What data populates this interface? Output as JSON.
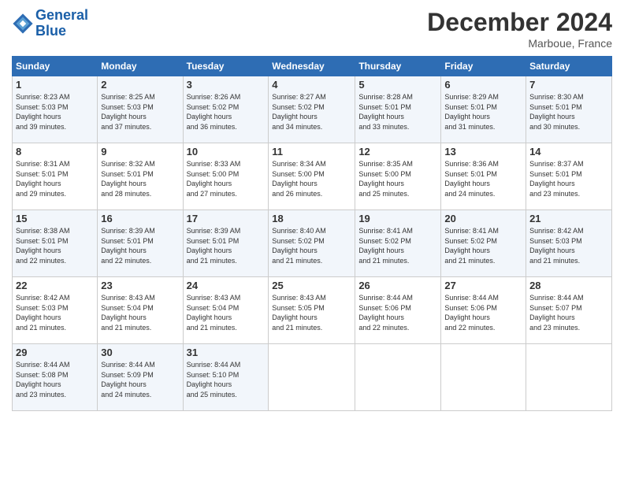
{
  "logo": {
    "line1": "General",
    "line2": "Blue"
  },
  "title": "December 2024",
  "location": "Marboue, France",
  "days_header": [
    "Sunday",
    "Monday",
    "Tuesday",
    "Wednesday",
    "Thursday",
    "Friday",
    "Saturday"
  ],
  "weeks": [
    [
      {
        "num": "1",
        "sunrise": "8:23 AM",
        "sunset": "5:03 PM",
        "daylight": "8 hours and 39 minutes."
      },
      {
        "num": "2",
        "sunrise": "8:25 AM",
        "sunset": "5:03 PM",
        "daylight": "8 hours and 37 minutes."
      },
      {
        "num": "3",
        "sunrise": "8:26 AM",
        "sunset": "5:02 PM",
        "daylight": "8 hours and 36 minutes."
      },
      {
        "num": "4",
        "sunrise": "8:27 AM",
        "sunset": "5:02 PM",
        "daylight": "8 hours and 34 minutes."
      },
      {
        "num": "5",
        "sunrise": "8:28 AM",
        "sunset": "5:01 PM",
        "daylight": "8 hours and 33 minutes."
      },
      {
        "num": "6",
        "sunrise": "8:29 AM",
        "sunset": "5:01 PM",
        "daylight": "8 hours and 31 minutes."
      },
      {
        "num": "7",
        "sunrise": "8:30 AM",
        "sunset": "5:01 PM",
        "daylight": "8 hours and 30 minutes."
      }
    ],
    [
      {
        "num": "8",
        "sunrise": "8:31 AM",
        "sunset": "5:01 PM",
        "daylight": "8 hours and 29 minutes."
      },
      {
        "num": "9",
        "sunrise": "8:32 AM",
        "sunset": "5:01 PM",
        "daylight": "8 hours and 28 minutes."
      },
      {
        "num": "10",
        "sunrise": "8:33 AM",
        "sunset": "5:00 PM",
        "daylight": "8 hours and 27 minutes."
      },
      {
        "num": "11",
        "sunrise": "8:34 AM",
        "sunset": "5:00 PM",
        "daylight": "8 hours and 26 minutes."
      },
      {
        "num": "12",
        "sunrise": "8:35 AM",
        "sunset": "5:00 PM",
        "daylight": "8 hours and 25 minutes."
      },
      {
        "num": "13",
        "sunrise": "8:36 AM",
        "sunset": "5:01 PM",
        "daylight": "8 hours and 24 minutes."
      },
      {
        "num": "14",
        "sunrise": "8:37 AM",
        "sunset": "5:01 PM",
        "daylight": "8 hours and 23 minutes."
      }
    ],
    [
      {
        "num": "15",
        "sunrise": "8:38 AM",
        "sunset": "5:01 PM",
        "daylight": "8 hours and 22 minutes."
      },
      {
        "num": "16",
        "sunrise": "8:39 AM",
        "sunset": "5:01 PM",
        "daylight": "8 hours and 22 minutes."
      },
      {
        "num": "17",
        "sunrise": "8:39 AM",
        "sunset": "5:01 PM",
        "daylight": "8 hours and 21 minutes."
      },
      {
        "num": "18",
        "sunrise": "8:40 AM",
        "sunset": "5:02 PM",
        "daylight": "8 hours and 21 minutes."
      },
      {
        "num": "19",
        "sunrise": "8:41 AM",
        "sunset": "5:02 PM",
        "daylight": "8 hours and 21 minutes."
      },
      {
        "num": "20",
        "sunrise": "8:41 AM",
        "sunset": "5:02 PM",
        "daylight": "8 hours and 21 minutes."
      },
      {
        "num": "21",
        "sunrise": "8:42 AM",
        "sunset": "5:03 PM",
        "daylight": "8 hours and 21 minutes."
      }
    ],
    [
      {
        "num": "22",
        "sunrise": "8:42 AM",
        "sunset": "5:03 PM",
        "daylight": "8 hours and 21 minutes."
      },
      {
        "num": "23",
        "sunrise": "8:43 AM",
        "sunset": "5:04 PM",
        "daylight": "8 hours and 21 minutes."
      },
      {
        "num": "24",
        "sunrise": "8:43 AM",
        "sunset": "5:04 PM",
        "daylight": "8 hours and 21 minutes."
      },
      {
        "num": "25",
        "sunrise": "8:43 AM",
        "sunset": "5:05 PM",
        "daylight": "8 hours and 21 minutes."
      },
      {
        "num": "26",
        "sunrise": "8:44 AM",
        "sunset": "5:06 PM",
        "daylight": "8 hours and 22 minutes."
      },
      {
        "num": "27",
        "sunrise": "8:44 AM",
        "sunset": "5:06 PM",
        "daylight": "8 hours and 22 minutes."
      },
      {
        "num": "28",
        "sunrise": "8:44 AM",
        "sunset": "5:07 PM",
        "daylight": "8 hours and 23 minutes."
      }
    ],
    [
      {
        "num": "29",
        "sunrise": "8:44 AM",
        "sunset": "5:08 PM",
        "daylight": "8 hours and 23 minutes."
      },
      {
        "num": "30",
        "sunrise": "8:44 AM",
        "sunset": "5:09 PM",
        "daylight": "8 hours and 24 minutes."
      },
      {
        "num": "31",
        "sunrise": "8:44 AM",
        "sunset": "5:10 PM",
        "daylight": "8 hours and 25 minutes."
      },
      null,
      null,
      null,
      null
    ]
  ]
}
